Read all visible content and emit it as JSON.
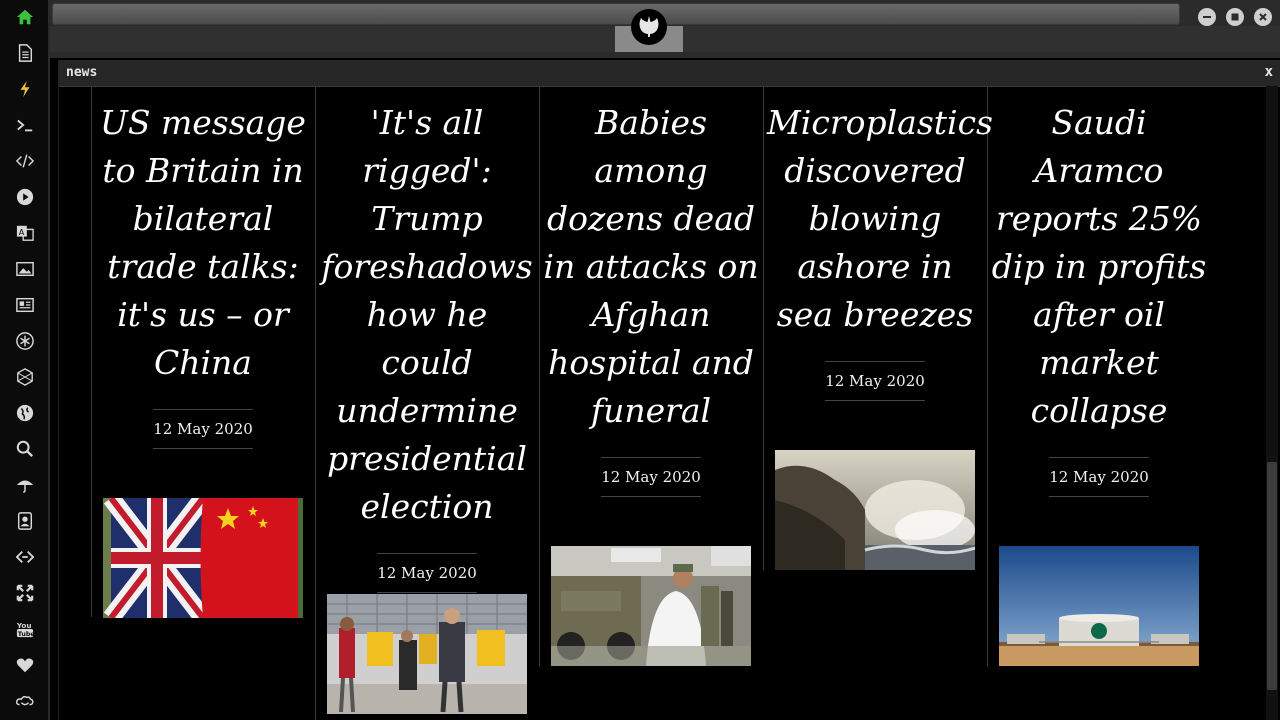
{
  "sidebar": {
    "icons": [
      "home-icon",
      "document-icon",
      "lightning-icon",
      "terminal-icon",
      "code-icon",
      "play-icon",
      "translate-icon",
      "image-icon",
      "newspaper-icon",
      "asterisk-icon",
      "hexagon-icon",
      "globe-icon",
      "search-icon",
      "umbrella-icon",
      "contact-card-icon",
      "dev-icon",
      "expand-icon",
      "youtube-icon",
      "heart-icon",
      "cloud-link-icon"
    ],
    "accent_home": "#3cbf3c",
    "accent_lightning": "#e8c33a"
  },
  "window": {
    "title": "news",
    "close_label": "x"
  },
  "articles": [
    {
      "headline": "US message to Britain in bilateral trade talks: it's us – or China",
      "date": "12 May 2020",
      "image": "uk-china-flags"
    },
    {
      "headline": "'It's all rigged': Trump foreshadows how he could undermine presidential election",
      "date": "12 May 2020",
      "image": "voting-booths"
    },
    {
      "headline": "Babies among dozens dead in attacks on Afghan hospital and funeral",
      "date": "12 May 2020",
      "image": "kabul-hospital-evacuation"
    },
    {
      "headline": "Microplastics discovered blowing ashore in sea breezes",
      "date": "12 May 2020",
      "image": "sea-spray-coast"
    },
    {
      "headline": "Saudi Aramco reports 25% dip in profits after oil market collapse",
      "date": "12 May 2020",
      "image": "aramco-oil-tanks"
    }
  ]
}
